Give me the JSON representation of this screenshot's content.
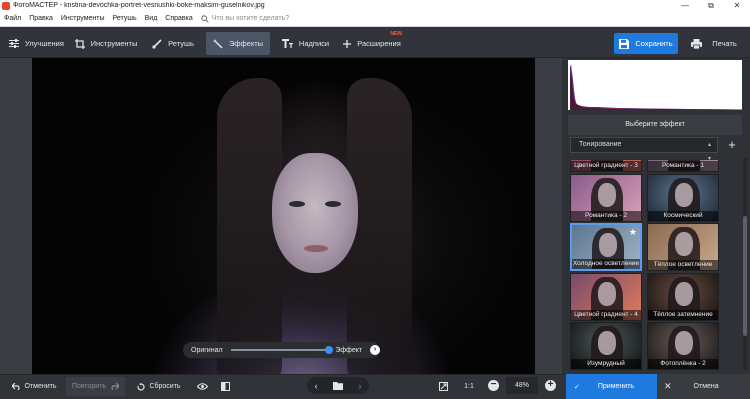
{
  "window": {
    "title": "ФотоМАСТЕР - kristina-devochka-portret-vesnushki-boke-maksim-guselnikov.jpg",
    "controls": [
      "—",
      "⧉",
      "✕"
    ]
  },
  "menu": {
    "items": [
      "Файл",
      "Правка",
      "Инструменты",
      "Ретушь",
      "Вид",
      "Справка"
    ],
    "search_placeholder": "Что вы хотите сделать?"
  },
  "toolbar": {
    "tabs": [
      {
        "label": "Улучшения",
        "icon": "sliders-icon"
      },
      {
        "label": "Инструменты",
        "icon": "crop-icon"
      },
      {
        "label": "Ретушь",
        "icon": "brush-icon"
      },
      {
        "label": "Эффекты",
        "icon": "magic-wand-icon",
        "active": true
      },
      {
        "label": "Надписи",
        "icon": "text-icon"
      },
      {
        "label": "Расширения",
        "icon": "plus-icon",
        "badge": "NEW"
      }
    ],
    "save_label": "Сохранить",
    "print_label": "Печать"
  },
  "canvas": {
    "compare_left": "Оригинал",
    "compare_right": "Эффект",
    "compare_level": 1.0
  },
  "panel": {
    "section_title": "Выберите эффект",
    "category": "Тонирование",
    "effects": [
      {
        "label": "Цветной градиент - 3"
      },
      {
        "label": "Романтика - 1"
      },
      {
        "label": "Романтика - 2"
      },
      {
        "label": "Космический"
      },
      {
        "label": "Холодное осветление",
        "selected": true,
        "favorite": true
      },
      {
        "label": "Тёплое осветление"
      },
      {
        "label": "Цветной градиент - 4"
      },
      {
        "label": "Тёплое затемнение"
      },
      {
        "label": "Изумрудный"
      },
      {
        "label": "Фотоплёнка - 2"
      }
    ]
  },
  "bottom": {
    "undo_label": "Отменить",
    "redo_label": "Повторить",
    "reset_label": "Сбросить",
    "ratio_label": "1:1",
    "zoom": "48%",
    "apply_label": "Применить",
    "cancel_label": "Отмена"
  },
  "colors": {
    "accent": "#1f7ae0",
    "badge_new": "#ff5a3c"
  }
}
